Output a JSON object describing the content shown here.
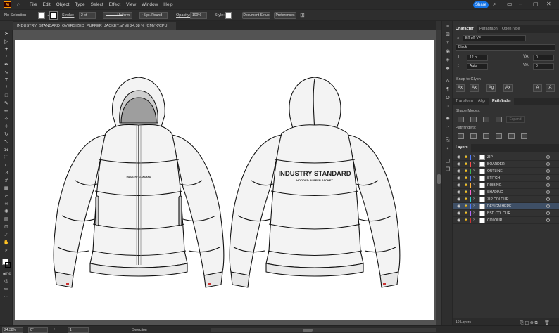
{
  "menu": {
    "app_logo": "Ai",
    "items": [
      "File",
      "Edit",
      "Object",
      "Type",
      "Select",
      "Effect",
      "View",
      "Window",
      "Help"
    ],
    "share_label": "Share"
  },
  "control_bar": {
    "selection_label": "No Selection",
    "stroke_label": "Stroke:",
    "stroke_weight": "2 pt",
    "profile": "Uniform",
    "brush": "5 pt. Round",
    "opacity_label": "Opacity:",
    "opacity_value": "100%",
    "style_label": "Style:",
    "document_setup": "Document Setup",
    "preferences": "Preferences"
  },
  "document_tab": {
    "title": "INDUSTRY_STANDARD_OVERSIZED_PUFFER_JACKET.ai* @ 24.38 % (CMYK/CPU Preview)",
    "close": "×"
  },
  "artwork": {
    "front_chest_label": "INDUSTRY STANDARD",
    "back_title": "INDUSTRY STANDARD",
    "back_subtitle": "HOODED PUFFER JACKET"
  },
  "character_panel": {
    "tabs": [
      "Character",
      "Paragraph",
      "OpenType"
    ],
    "font_family": "Effra® VF",
    "font_style": "Black",
    "font_size": "12 pt",
    "leading": "Auto",
    "kerning": "0",
    "tracking": "0",
    "snap_to_glyph": "Snap to Glyph",
    "glyph_buttons": [
      "Ax",
      "Ax",
      "Ag",
      "Ax",
      "A",
      "A"
    ]
  },
  "pathfinder_panel": {
    "tabs": [
      "Transform",
      "Align",
      "Pathfinder"
    ],
    "shape_modes_label": "Shape Modes:",
    "pathfinders_label": "Pathfinders:",
    "expand_label": "Expand"
  },
  "layers_panel": {
    "title": "Layers",
    "layers": [
      {
        "name": "ZIP",
        "color": "#4f7cff",
        "selected": false
      },
      {
        "name": "BOARDER",
        "color": "#ff4f4f",
        "selected": false
      },
      {
        "name": "OUTLINE",
        "color": "#3fb34f",
        "selected": false
      },
      {
        "name": "STITCH",
        "color": "#4f7cff",
        "selected": false
      },
      {
        "name": "RIBBING",
        "color": "#ffb340",
        "selected": false
      },
      {
        "name": "SHADING",
        "color": "#ff66cc",
        "selected": false
      },
      {
        "name": "ZIP COLOUR",
        "color": "#33cccc",
        "selected": false
      },
      {
        "name": "DESIGN HERE",
        "color": "#4f7cff",
        "selected": true
      },
      {
        "name": "BSD COLOUR",
        "color": "#b36bff",
        "selected": false
      },
      {
        "name": "COLOUR",
        "color": "#cc3333",
        "selected": false
      }
    ],
    "count_label": "10 Layers"
  },
  "status_bar": {
    "zoom": "24.38%",
    "rotation": "0°",
    "artboard": "1",
    "tool": "Selection"
  }
}
